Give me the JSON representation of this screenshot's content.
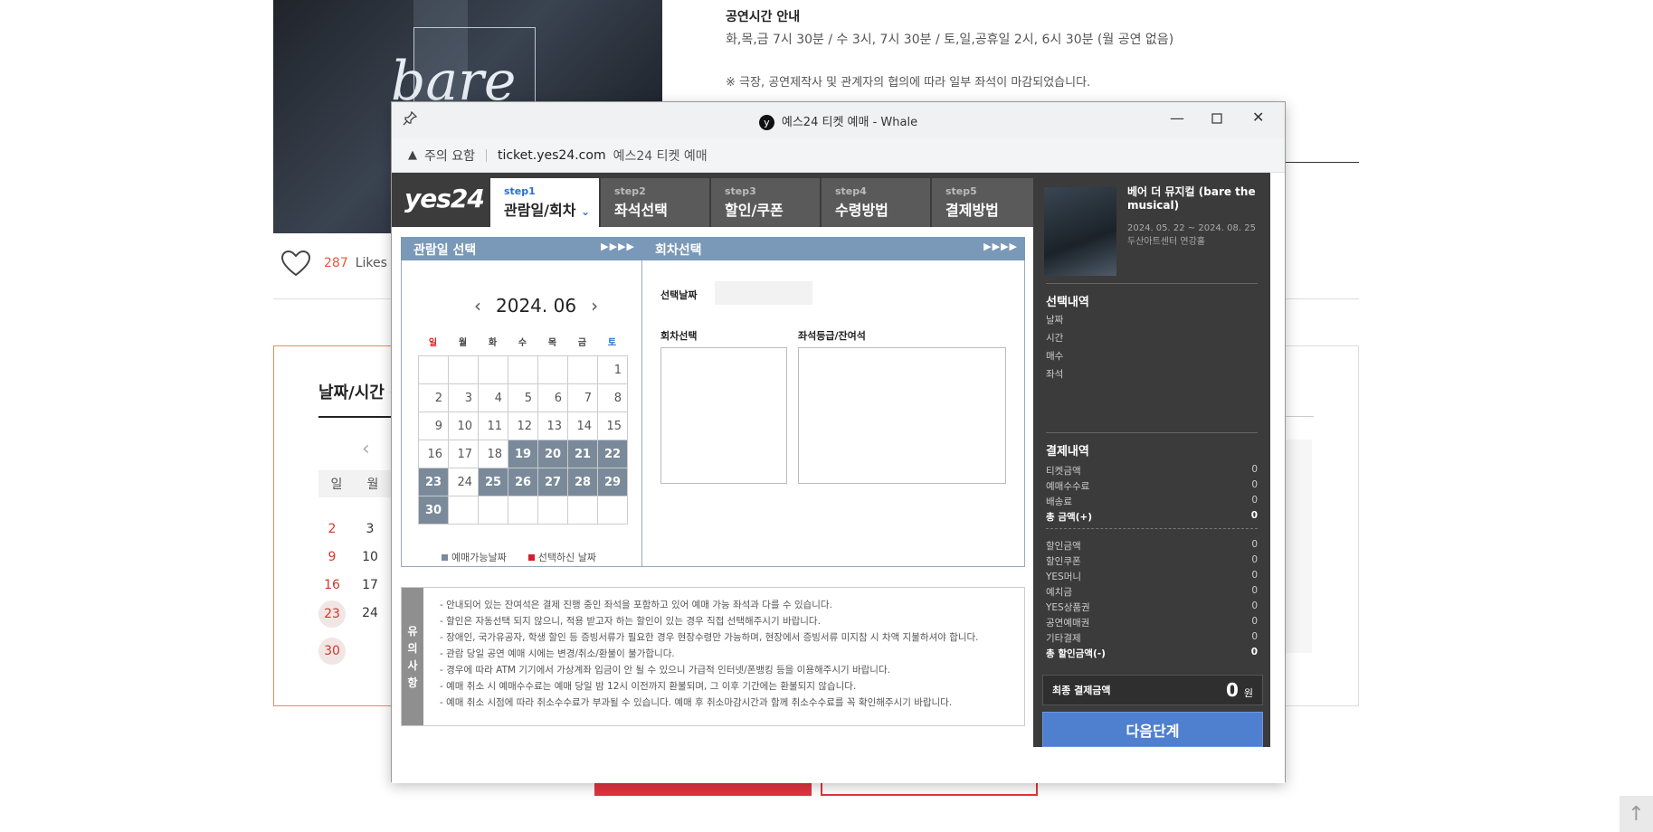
{
  "background": {
    "poster_word": "bare",
    "info_title": "공연시간 안내",
    "info_line": "화,목,금 7시 30분 / 수 3시, 7시 30분 / 토,일,공휴일 2시, 6시 30분 (월 공연 없음)",
    "info_note": "※ 극장, 공연제작사 및 관계자의 협의에 따라 일부 좌석이 마감되었습니다.",
    "likes_count": "287",
    "likes_label": "Likes",
    "booking_title": "날짜/시간 선",
    "weekday_sun": "일",
    "weekday_mon": "월",
    "rows": [
      [
        "2",
        "3"
      ],
      [
        "9",
        "10"
      ],
      [
        "16",
        "17"
      ],
      [
        "23",
        "24"
      ],
      [
        "30"
      ]
    ]
  },
  "window": {
    "title": "예스24 티켓 예매 - Whale",
    "title_icon": "y",
    "address_warning": "주의 요함",
    "url": "ticket.yes24.com",
    "site_name": "예스24 티켓 예매"
  },
  "app": {
    "logo": "yes24",
    "steps": [
      {
        "num": "step1",
        "label": "관람일/회차"
      },
      {
        "num": "step2",
        "label": "좌석선택"
      },
      {
        "num": "step3",
        "label": "할인/쿠폰"
      },
      {
        "num": "step4",
        "label": "수령방법"
      },
      {
        "num": "step5",
        "label": "결제방법"
      }
    ],
    "date_panel_title": "관람일 선택",
    "round_panel_title": "회차선택",
    "panel_arrows": "▶▶▶▶",
    "calendar": {
      "month": "2024. 06",
      "weekdays": [
        "일",
        "월",
        "화",
        "수",
        "목",
        "금",
        "토"
      ],
      "weeks": [
        [
          "",
          "",
          "",
          "",
          "",
          "",
          "1"
        ],
        [
          "2",
          "3",
          "4",
          "5",
          "6",
          "7",
          "8"
        ],
        [
          "9",
          "10",
          "11",
          "12",
          "13",
          "14",
          "15"
        ],
        [
          "16",
          "17",
          "18",
          "19",
          "20",
          "21",
          "22"
        ],
        [
          "23",
          "24",
          "25",
          "26",
          "27",
          "28",
          "29"
        ],
        [
          "30",
          "",
          "",
          "",
          "",
          "",
          ""
        ]
      ],
      "available": [
        "19",
        "20",
        "21",
        "22",
        "23",
        "25",
        "26",
        "27",
        "28",
        "29",
        "30"
      ]
    },
    "legend_available": "예매가능날짜",
    "legend_selected": "선택하신 날짜",
    "selected_date_label": "선택날짜",
    "round_select_label": "회차선택",
    "seat_grade_label": "좌석등급/잔여석",
    "notice_side": [
      "유",
      "의",
      "사",
      "항"
    ],
    "notices": [
      "- 안내되어 있는 잔여석은 결제 진행 중인 좌석을 포함하고 있어 예매 가능 좌석과 다를 수 있습니다.",
      "- 할인은 자동선택 되지 않으니, 적용 받고자 하는 할인이 있는 경우 직접 선택해주시기 바랍니다.",
      "- 장애인, 국가유공자, 학생 할인 등 증빙서류가 필요한 경우 현장수령만 가능하며, 현장에서 증빙서류 미지참 시 차액 지불하셔야 합니다.",
      "- 관람 당일 공연 예매 시에는 변경/취소/환불이 불가합니다.",
      "- 경우에 따라 ATM 기기에서 가상계좌 입금이 안 될 수 있으니 가급적 인터넷/폰뱅킹 등을 이용해주시기 바랍니다.",
      "- 예매 취소 시 예매수수료는 예매 당일 밤 12시 이전까지 환불되며, 그 이후 기간에는 환불되지 않습니다.",
      "- 예매 취소 시점에 따라 취소수수료가 부과될 수 있습니다. 예매 후 취소마감시간과 함께 취소수수료를 꼭 확인해주시기 바랍니다."
    ],
    "show": {
      "title": "베어 더 뮤지컬 (bare the musical)",
      "period": "2024. 05. 22 ~ 2024. 08. 25",
      "venue": "두산아트센터 연강홀"
    },
    "selection": {
      "title": "선택내역",
      "items": [
        "날짜",
        "시간",
        "매수",
        "좌석"
      ]
    },
    "payment": {
      "title": "결제내역",
      "items": [
        {
          "label": "티켓금액",
          "value": "0"
        },
        {
          "label": "예매수수료",
          "value": "0"
        },
        {
          "label": "배송료",
          "value": "0"
        }
      ],
      "total": {
        "label": "총 금액(+)",
        "value": "0"
      },
      "discounts": [
        {
          "label": "할인금액",
          "value": "0"
        },
        {
          "label": "할인쿠폰",
          "value": "0"
        },
        {
          "label": "YES머니",
          "value": "0"
        },
        {
          "label": "예치금",
          "value": "0"
        },
        {
          "label": "YES상품권",
          "value": "0"
        },
        {
          "label": "공연예매권",
          "value": "0"
        },
        {
          "label": "기타결제",
          "value": "0"
        }
      ],
      "discount_total": {
        "label": "총 할인금액(-)",
        "value": "0"
      }
    },
    "final_label": "최종 결제금액",
    "final_amount": "0",
    "final_unit": "원",
    "next_button": "다음단계"
  },
  "colors": {
    "accent_blue": "#4f7fcf",
    "available_day": "#7a8a9a",
    "brand_red": "#e2343f",
    "panel_head": "#7a98b8"
  }
}
